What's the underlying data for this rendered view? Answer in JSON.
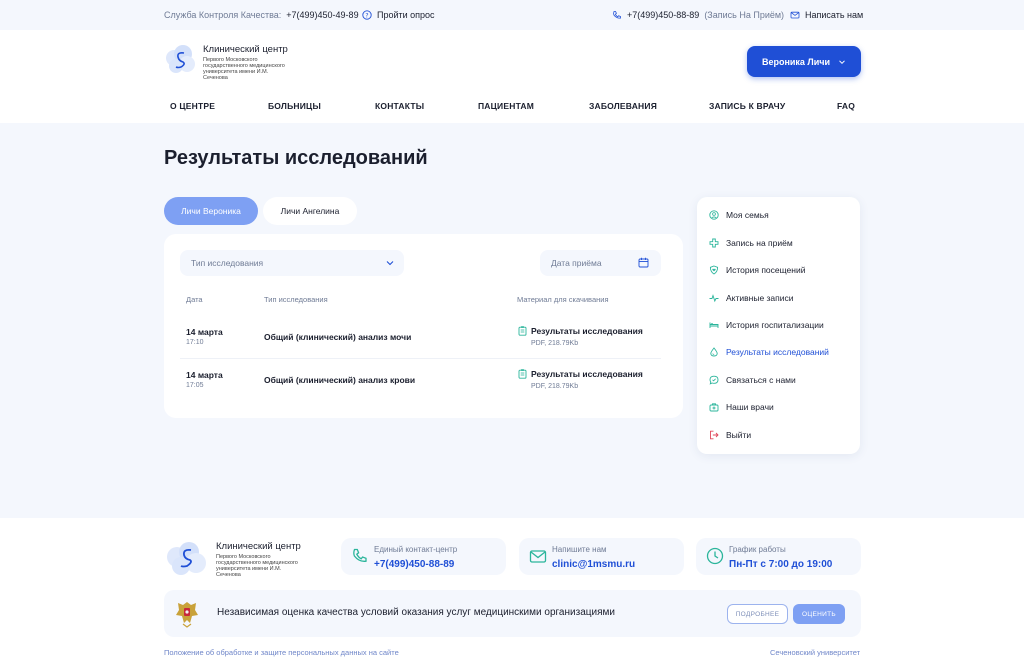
{
  "topbar": {
    "quality_label": "Служба Контроля Качества:",
    "quality_phone": "+7(499)450-49-89",
    "survey": "Пройти опрос",
    "appointment_phone": "+7(499)450-88-89",
    "appointment_note": "(Запись На Приём)",
    "write_us": "Написать нам"
  },
  "logo": {
    "title": "Клинический центр",
    "subtitle": "Первого Московского государственного медицинского университета имени И.М. Сеченова"
  },
  "user_button": "Вероника Личи",
  "nav": [
    "О ЦЕНТРЕ",
    "БОЛЬНИЦЫ",
    "КОНТАКТЫ",
    "ПАЦИЕНТАМ",
    "ЗАБОЛЕВАНИЯ",
    "ЗАПИСЬ К ВРАЧУ",
    "FAQ"
  ],
  "page_title": "Результаты исследований",
  "patients": [
    "Личи Вероника",
    "Личи Ангелина"
  ],
  "filters": {
    "type_placeholder": "Тип исследования",
    "date_placeholder": "Дата приёма"
  },
  "table": {
    "headers": [
      "Дата",
      "Тип исследования",
      "Материал для скачивания"
    ],
    "rows": [
      {
        "date": "14 марта",
        "time": "17:10",
        "type": "Общий (клинический) анализ мочи",
        "file": "Результаты исследования",
        "meta": "PDF, 218.79Kb"
      },
      {
        "date": "14 марта",
        "time": "17:05",
        "type": "Общий (клинический) анализ крови",
        "file": "Результаты исследования",
        "meta": "PDF, 218.79Kb"
      }
    ]
  },
  "sidebar": {
    "items": [
      {
        "label": "Моя семья",
        "icon": "family-icon"
      },
      {
        "label": "Запись на приём",
        "icon": "medical-cross-icon"
      },
      {
        "label": "История посещений",
        "icon": "shield-heart-icon"
      },
      {
        "label": "Активные записи",
        "icon": "pulse-icon"
      },
      {
        "label": "История госпитализации",
        "icon": "bed-icon"
      },
      {
        "label": "Результаты исследований",
        "icon": "drop-icon"
      },
      {
        "label": "Связаться с нами",
        "icon": "chat-icon"
      },
      {
        "label": "Наши врачи",
        "icon": "doctor-bag-icon"
      },
      {
        "label": "Выйти",
        "icon": "logout-icon"
      }
    ]
  },
  "footer": {
    "contacts": [
      {
        "label": "Единый контакт-центр",
        "value": "+7(499)450-88-89",
        "icon": "phone-icon"
      },
      {
        "label": "Напишите нам",
        "value": "clinic@1msmu.ru",
        "icon": "mail-icon"
      },
      {
        "label": "График работы",
        "value": "Пн-Пт с 7:00 до 19:00",
        "icon": "clock-icon"
      }
    ],
    "banner_text": "Независимая оценка качества условий оказания услуг медицинскими организациями",
    "more_button": "ПОДРОБНЕЕ",
    "rate_button": "ОЦЕНИТЬ",
    "privacy_link": "Положение об обработке и защите персональных данных на сайте",
    "university_link": "Сеченовский университет"
  },
  "colors": {
    "accent": "#1f4fd6",
    "accent_light": "#7ea0f3",
    "icon_teal": "#2bb59b",
    "logout_red": "#e0475a",
    "background": "#f4f7fd"
  }
}
